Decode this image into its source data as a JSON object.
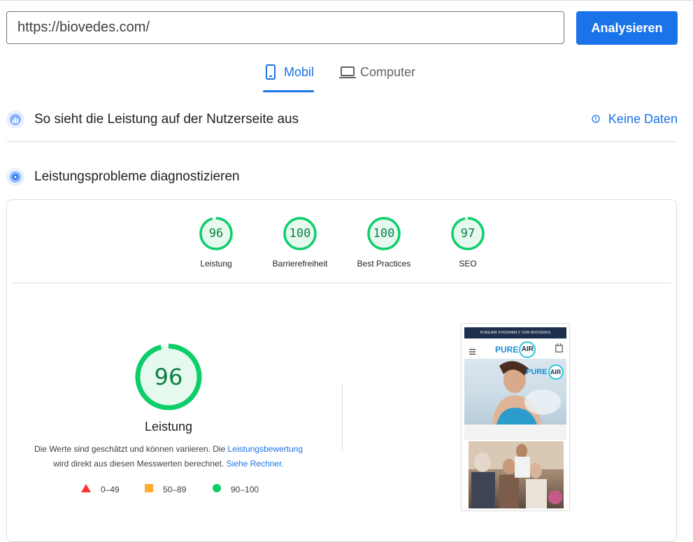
{
  "url_bar": {
    "value": "https://biovedes.com/",
    "analyze_label": "Analysieren"
  },
  "tabs": [
    {
      "label": "Mobil",
      "icon": "smartphone-icon",
      "active": true
    },
    {
      "label": "Computer",
      "icon": "laptop-icon",
      "active": false
    }
  ],
  "field_section": {
    "title": "So sieht die Leistung auf der Nutzerseite aus",
    "no_data_label": "Keine Daten"
  },
  "lab_section": {
    "title": "Leistungsprobleme diagnostizieren"
  },
  "categories": [
    {
      "score": "96",
      "label": "Leistung"
    },
    {
      "score": "100",
      "label": "Barrierefreiheit"
    },
    {
      "score": "100",
      "label": "Best Practices"
    },
    {
      "score": "97",
      "label": "SEO"
    }
  ],
  "performance": {
    "score": "96",
    "title": "Leistung",
    "desc_part1": "Die Werte sind geschätzt und können variieren. Die",
    "desc_link1": "Leistungsbewertung",
    "desc_part2": "wird direkt aus diesen Messwerten berechnet.",
    "desc_link2": "Siehe Rechner."
  },
  "legend": [
    {
      "label": "0–49",
      "shape": "triangle",
      "color": "#ff3333"
    },
    {
      "label": "50–89",
      "shape": "square",
      "color": "#ffaa33"
    },
    {
      "label": "90–100",
      "shape": "circle",
      "color": "#0cce6b"
    }
  ],
  "screenshot": {
    "banner_text": "PUREAIR FOODAMILY VON BIOVEDES",
    "logo_text_1": "PURE",
    "logo_text_2": "AIR"
  },
  "colors": {
    "accent": "#1a73e8",
    "pass": "#0cce6b",
    "pass_text": "#0b8043"
  }
}
